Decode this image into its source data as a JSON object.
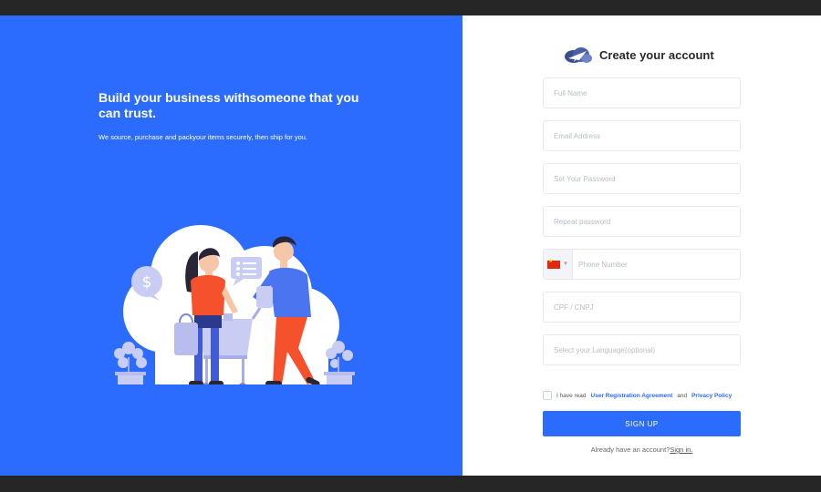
{
  "hero": {
    "title": "Build your business withsomeone that you can trust.",
    "subtitle": "We source, purchase and packyour items securely, then ship for you."
  },
  "brand": {
    "title": "Create your account",
    "logo_icon": "cloud-plane-icon"
  },
  "form": {
    "full_name": {
      "placeholder": "Full Name",
      "value": ""
    },
    "email": {
      "placeholder": "Email Address",
      "value": ""
    },
    "password": {
      "placeholder": "Set Your Password",
      "value": ""
    },
    "repeat_password": {
      "placeholder": "Repeat password",
      "value": ""
    },
    "phone": {
      "placeholder": "Phone Number",
      "value": "",
      "country_flag_icon": "china-flag-icon"
    },
    "cpf": {
      "placeholder": "CPF / CNPJ",
      "value": ""
    },
    "language": {
      "placeholder": "Select your Language(optional)",
      "value": ""
    }
  },
  "agreement": {
    "prefix": "I have read",
    "registration_link": "User Registration Agreement",
    "and": "and",
    "privacy_link": "Privacy Policy"
  },
  "signup_label": "SIGN UP",
  "signin": {
    "prompt": "Already have an account?",
    "link": "Sign in."
  },
  "colors": {
    "brand_blue": "#2b6cff",
    "shirt_red": "#f4512c",
    "accent_lavender": "#c9cdf4"
  }
}
